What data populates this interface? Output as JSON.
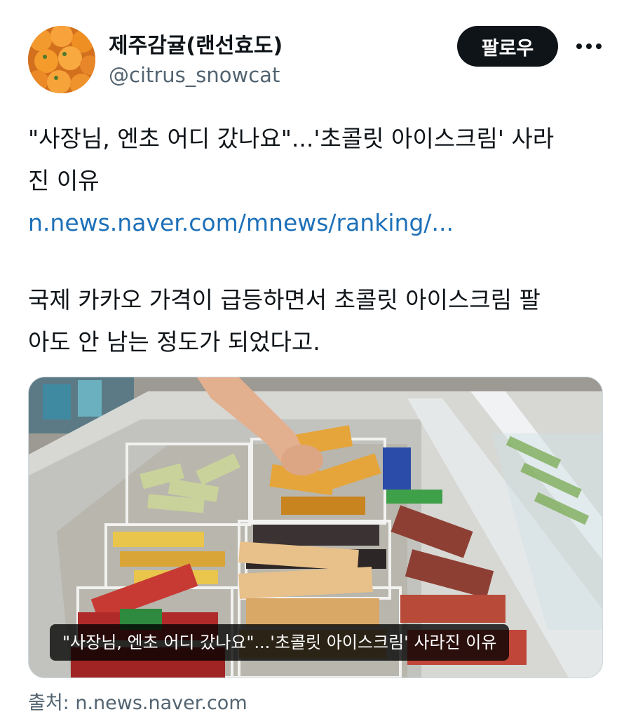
{
  "author": {
    "display_name": "제주감귤(랜선효도)",
    "handle": "@citrus_snowcat",
    "avatar_icon": "oranges-avatar"
  },
  "actions": {
    "follow_label": "팔로우",
    "more_icon": "more-dots-icon"
  },
  "tweet": {
    "line1": "\"사장님, 엔초 어디 갔나요\"...'초콜릿 아이스크림' 사라",
    "line2": "진 이유",
    "link": "n.news.naver.com/mnews/ranking/...",
    "para_line1": "국제 카카오 가격이 급등하면서 초콜릿 아이스크림 팔",
    "para_line2": "아도 안 남는 정도가 되었다고."
  },
  "card": {
    "caption": "\"사장님, 엔초 어디 갔나요\"...'초콜릿 아이스크림' 사라진 이유",
    "image_subject": "ice-cream-freezer-photo",
    "source": "출처: n.news.naver.com"
  },
  "colors": {
    "link": "#1d70b8",
    "muted": "#536471",
    "button_bg": "#0f1419"
  }
}
